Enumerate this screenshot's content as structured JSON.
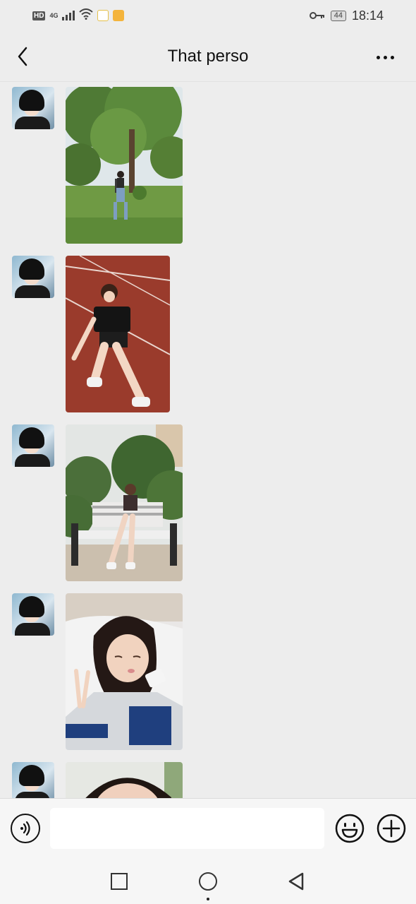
{
  "status_bar": {
    "hd_label": "HD",
    "network_label": "4G",
    "battery_level": "44",
    "time": "18:14",
    "icons": [
      "signal-icon",
      "wifi-icon",
      "app-notification-icon",
      "key-icon",
      "battery-icon"
    ]
  },
  "header": {
    "title": "That perso",
    "back_icon": "chevron-left-icon",
    "more_icon": "more-dots-icon"
  },
  "messages": [
    {
      "sender": "contact",
      "type": "image",
      "scene": "park-tree",
      "avatar": "anime-avatar"
    },
    {
      "sender": "contact",
      "type": "image",
      "scene": "running-track",
      "avatar": "anime-avatar"
    },
    {
      "sender": "contact",
      "type": "image",
      "scene": "bench-garden",
      "avatar": "anime-avatar"
    },
    {
      "sender": "contact",
      "type": "image",
      "scene": "bed-selfie",
      "avatar": "anime-avatar"
    },
    {
      "sender": "contact",
      "type": "image",
      "scene": "face-closeup-partial",
      "avatar": "anime-avatar"
    }
  ],
  "input_bar": {
    "text_value": "",
    "voice_icon": "voice-icon",
    "emoji_icon": "emoji-icon",
    "plus_icon": "plus-icon"
  },
  "system_nav": {
    "icons": [
      "recent-apps-icon",
      "home-icon",
      "back-triangle-icon"
    ]
  },
  "colors": {
    "background": "#ededed",
    "input_bar": "#f6f6f6",
    "text_primary": "#111111"
  }
}
